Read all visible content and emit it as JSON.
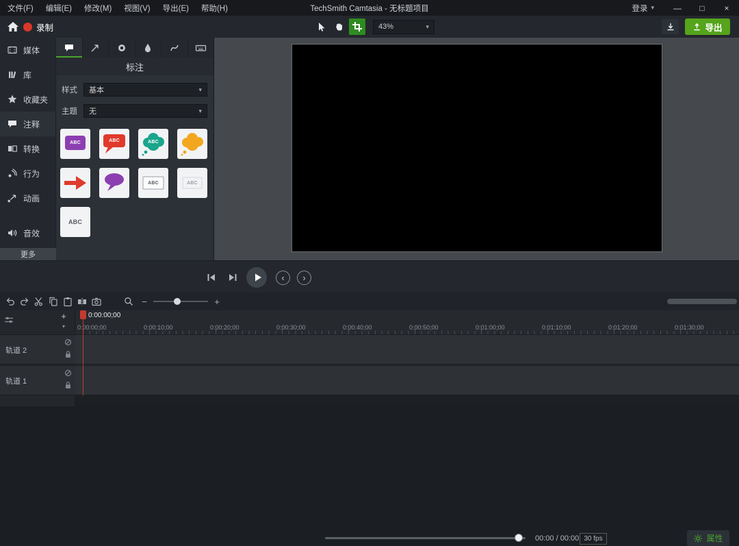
{
  "icons": {
    "caret_down": "▾",
    "minimize": "—",
    "maximize": "□",
    "close": "×",
    "chevron_left": "‹",
    "chevron_right": "›",
    "plus": "+",
    "minus": "−"
  },
  "colors": {
    "accent_green": "#55a41c",
    "active_tool_green": "#2f8b21",
    "record_red": "#d9372a",
    "playhead_red": "#c23b2e"
  },
  "menubar": {
    "menus": [
      "文件(F)",
      "编辑(E)",
      "修改(M)",
      "视图(V)",
      "导出(E)",
      "帮助(H)"
    ],
    "title": "TechSmith Camtasia - 无标题项目",
    "login_label": "登录"
  },
  "toolbar": {
    "record_label": "录制",
    "zoom_value": "43%",
    "export_label": "导出"
  },
  "sidebar": {
    "items": [
      {
        "label": "媒体",
        "active": false
      },
      {
        "label": "库",
        "active": false
      },
      {
        "label": "收藏夹",
        "active": false
      },
      {
        "label": "注释",
        "active": true
      },
      {
        "label": "转换",
        "active": false
      },
      {
        "label": "行为",
        "active": false
      },
      {
        "label": "动画",
        "active": false
      },
      {
        "label": "音效",
        "active": false
      }
    ],
    "more_label": "更多"
  },
  "annotations_panel": {
    "title": "标注",
    "style_label": "样式",
    "style_value": "基本",
    "theme_label": "主题",
    "theme_value": "无",
    "thumbnails": [
      {
        "name": "rectangle-callout",
        "color": "#8c3fb1",
        "text": "ABC"
      },
      {
        "name": "speech-bubble-callout",
        "color": "#e03a2c",
        "text": "ABC"
      },
      {
        "name": "cloud-callout",
        "color": "#1aa58c",
        "text": "ABC"
      },
      {
        "name": "thought-cloud-callout",
        "color": "#f2a71e",
        "text": ""
      },
      {
        "name": "arrow-callout",
        "color": "#e03a2c",
        "text": ""
      },
      {
        "name": "oval-bubble-callout",
        "color": "#8c3fb1",
        "text": ""
      },
      {
        "name": "text-box-callout",
        "color": "#ffffff",
        "text": "ABC"
      },
      {
        "name": "plain-text-callout",
        "color": "",
        "text": "ABC"
      },
      {
        "name": "keystroke-callout",
        "color": "",
        "text": "ABC"
      }
    ]
  },
  "playback": {
    "time_display": "00:00 / 00:00",
    "fps_label": "30 fps",
    "properties_label": "属性"
  },
  "timeline": {
    "playhead_time": "0:00:00;00",
    "ruler_labels": [
      "0:00:00;00",
      "0:00:10;00",
      "0:00:20;00",
      "0:00:30;00",
      "0:00:40;00",
      "0:00:50;00",
      "0:01:00;00",
      "0:01:10;00",
      "0:01:20;00",
      "0:01:30;00"
    ],
    "tracks": [
      {
        "label": "轨道 2"
      },
      {
        "label": "轨道 1"
      }
    ]
  }
}
